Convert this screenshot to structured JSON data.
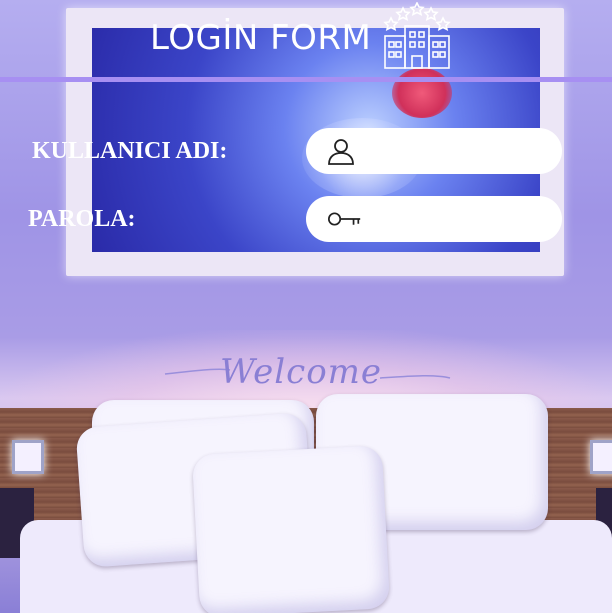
{
  "header": {
    "title": "LOGİN FORM",
    "icon": "hotel-building-icon"
  },
  "form": {
    "username_label": "KULLANICI ADI:",
    "username_value": "",
    "username_icon": "user-icon",
    "password_label": "PAROLA:",
    "password_value": "",
    "password_icon": "key-icon"
  },
  "background": {
    "welcome_text": "Welcome"
  },
  "colors": {
    "accent": "#a78ff2",
    "welcome": "#8a7fd4",
    "text": "#ffffff"
  }
}
